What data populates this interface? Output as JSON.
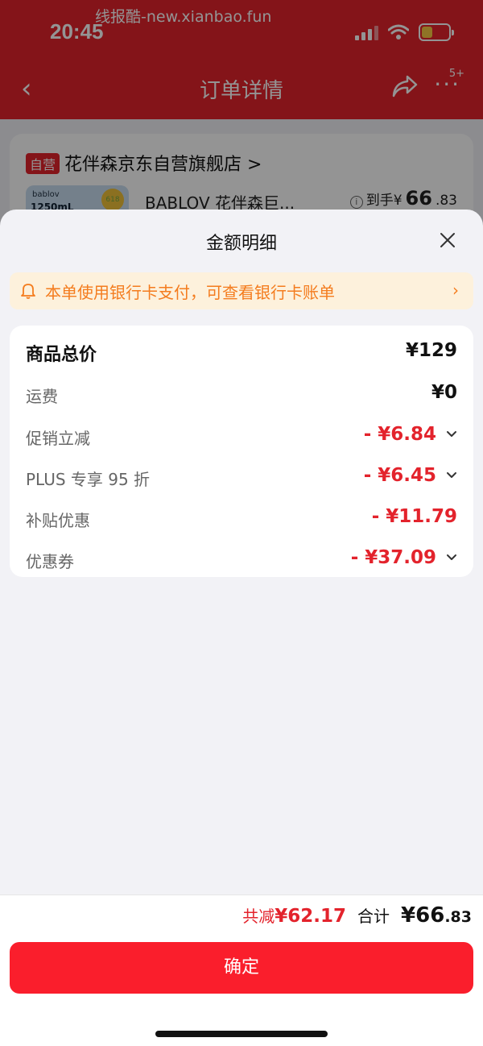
{
  "watermark": "线报酷-new.xianbao.fun",
  "status_bar": {
    "time": "20:45"
  },
  "nav": {
    "back_icon": "‹",
    "title": "订单详情",
    "more_icon": "···",
    "badge": "5+"
  },
  "store": {
    "tag": "自营",
    "name": "花伴森京东自营旗舰店 >",
    "product_thumb": {
      "brand": "bablov",
      "volume": "1250mL",
      "seal": "618"
    },
    "product_name": "BABLOV 花伴森巨...",
    "price_info_icon": "i",
    "price_prefix": "到手¥",
    "price_int": "66",
    "price_dec": ".83"
  },
  "sheet": {
    "title": "金额明细",
    "notice": {
      "text": "本单使用银行卡支付，可查看银行卡账单",
      "chevron": "›"
    },
    "rows": [
      {
        "label": "商品总价",
        "value": "¥129"
      },
      {
        "label": "运费",
        "value": "¥0"
      },
      {
        "label": "促销立减",
        "value": "- ¥6.84"
      },
      {
        "label": "PLUS 专享 95 折",
        "value": "- ¥6.45"
      },
      {
        "label": "补贴优惠",
        "value": "- ¥11.79"
      },
      {
        "label": "优惠券",
        "value": "- ¥37.09"
      }
    ]
  },
  "footer": {
    "saved_label": "共减",
    "saved_amount": "¥62.17",
    "total_label": "合计",
    "total_prefix": "¥",
    "total_int": "66",
    "total_dec": ".83",
    "confirm_label": "确定"
  },
  "colors": {
    "accent": "#e3232c",
    "button": "#fa1e2c",
    "notice_bg": "#fdf1dc",
    "notice_text": "#f47c1e"
  }
}
